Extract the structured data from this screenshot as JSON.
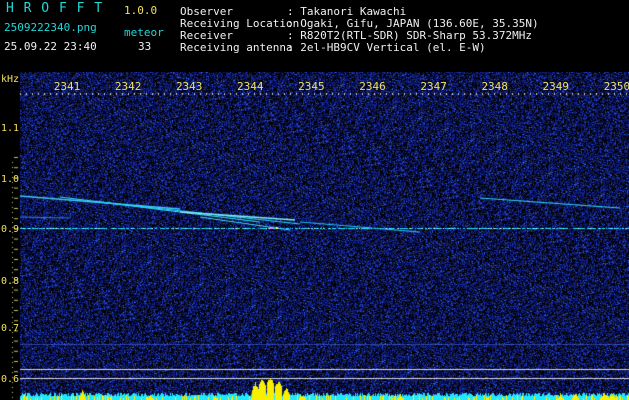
{
  "header": {
    "logo": "H R O F F T",
    "version": "1.0.0",
    "filename": "2509222340.png",
    "mode": "meteor",
    "datetime": "25.09.22 23:40",
    "count": "33",
    "observer_label": "Observer",
    "observer_value": ": Takanori Kawachi",
    "location_label": "Receiving Location",
    "location_value": ": Ogaki, Gifu, JAPAN (136.60E, 35.35N)",
    "receiver_label": "Receiver",
    "receiver_value": ": R820T2(RTL-SDR) SDR-Sharp 53.372MHz",
    "antenna_label": "Receiving antenna",
    "antenna_value": ": 2el-HB9CV Vertical (el. E-W)"
  },
  "axis": {
    "y_unit": "kHz",
    "y_ticks": [
      "1.1",
      "1.0",
      "0.9",
      "0.8",
      "0.7",
      "0.6"
    ],
    "x_ticks": [
      "2341",
      "2342",
      "2343",
      "2344",
      "2345",
      "2346",
      "2347",
      "2348",
      "2349",
      "2350"
    ]
  },
  "colors": {
    "background": "#000000",
    "noise": "#1a2a9a",
    "signal": "#20e8ff",
    "level": "#f8f000",
    "axis_text": "#f0e060",
    "header_cyan": "#21d7d7"
  }
}
